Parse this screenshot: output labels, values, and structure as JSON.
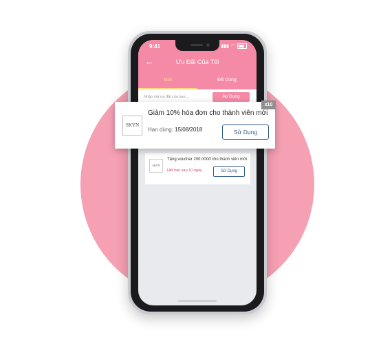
{
  "status": {
    "time": "9:41"
  },
  "header": {
    "title": "Ưu Đãi Của Tôi"
  },
  "tabs": [
    {
      "label": "Mới"
    },
    {
      "label": "Đã Dùng"
    }
  ],
  "promo": {
    "placeholder": "Nhập mã ưu đãi của bạn...",
    "apply_label": "Áp Dụng"
  },
  "featured_voucher": {
    "logo_text": "SKYN",
    "title": "Giảm 10% hóa đơn cho thành viên mới",
    "expiry_label": "Hạn dùng: ",
    "expiry_date": "15/08/2018",
    "button_label": "Sử Dụng",
    "quantity": "x10"
  },
  "vouchers": [
    {
      "logo_text": "SKYN",
      "title": "Tặng voucher 200.000đ cho thành viên mới",
      "expiry": "Hết hạn sau 10 ngày",
      "button_label": "Sử Dụng"
    }
  ],
  "colors": {
    "brand_pink": "#f48aa6",
    "accent_yellow": "#ffd88a",
    "button_blue": "#2f5a8b",
    "backdrop_circle": "#f6a0b3"
  }
}
